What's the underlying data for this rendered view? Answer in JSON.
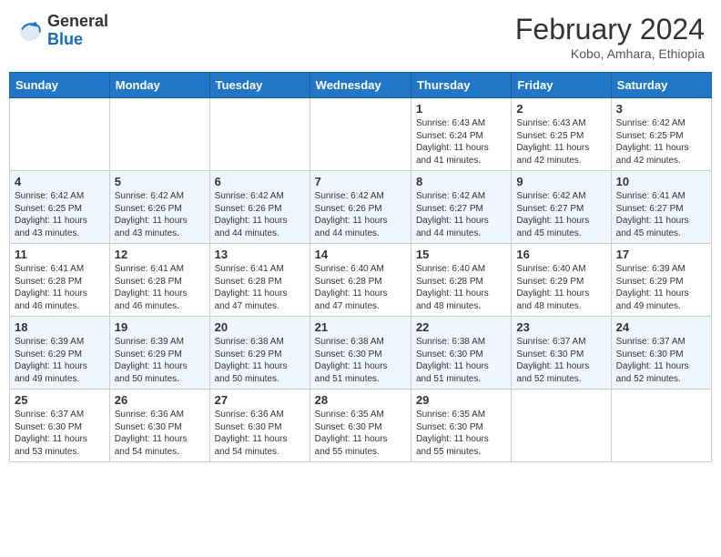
{
  "header": {
    "logo_general": "General",
    "logo_blue": "Blue",
    "month_year": "February 2024",
    "location": "Kobo, Amhara, Ethiopia"
  },
  "weekdays": [
    "Sunday",
    "Monday",
    "Tuesday",
    "Wednesday",
    "Thursday",
    "Friday",
    "Saturday"
  ],
  "weeks": [
    [
      {
        "day": "",
        "info": ""
      },
      {
        "day": "",
        "info": ""
      },
      {
        "day": "",
        "info": ""
      },
      {
        "day": "",
        "info": ""
      },
      {
        "day": "1",
        "info": "Sunrise: 6:43 AM\nSunset: 6:24 PM\nDaylight: 11 hours\nand 41 minutes."
      },
      {
        "day": "2",
        "info": "Sunrise: 6:43 AM\nSunset: 6:25 PM\nDaylight: 11 hours\nand 42 minutes."
      },
      {
        "day": "3",
        "info": "Sunrise: 6:42 AM\nSunset: 6:25 PM\nDaylight: 11 hours\nand 42 minutes."
      }
    ],
    [
      {
        "day": "4",
        "info": "Sunrise: 6:42 AM\nSunset: 6:25 PM\nDaylight: 11 hours\nand 43 minutes."
      },
      {
        "day": "5",
        "info": "Sunrise: 6:42 AM\nSunset: 6:26 PM\nDaylight: 11 hours\nand 43 minutes."
      },
      {
        "day": "6",
        "info": "Sunrise: 6:42 AM\nSunset: 6:26 PM\nDaylight: 11 hours\nand 44 minutes."
      },
      {
        "day": "7",
        "info": "Sunrise: 6:42 AM\nSunset: 6:26 PM\nDaylight: 11 hours\nand 44 minutes."
      },
      {
        "day": "8",
        "info": "Sunrise: 6:42 AM\nSunset: 6:27 PM\nDaylight: 11 hours\nand 44 minutes."
      },
      {
        "day": "9",
        "info": "Sunrise: 6:42 AM\nSunset: 6:27 PM\nDaylight: 11 hours\nand 45 minutes."
      },
      {
        "day": "10",
        "info": "Sunrise: 6:41 AM\nSunset: 6:27 PM\nDaylight: 11 hours\nand 45 minutes."
      }
    ],
    [
      {
        "day": "11",
        "info": "Sunrise: 6:41 AM\nSunset: 6:28 PM\nDaylight: 11 hours\nand 46 minutes."
      },
      {
        "day": "12",
        "info": "Sunrise: 6:41 AM\nSunset: 6:28 PM\nDaylight: 11 hours\nand 46 minutes."
      },
      {
        "day": "13",
        "info": "Sunrise: 6:41 AM\nSunset: 6:28 PM\nDaylight: 11 hours\nand 47 minutes."
      },
      {
        "day": "14",
        "info": "Sunrise: 6:40 AM\nSunset: 6:28 PM\nDaylight: 11 hours\nand 47 minutes."
      },
      {
        "day": "15",
        "info": "Sunrise: 6:40 AM\nSunset: 6:28 PM\nDaylight: 11 hours\nand 48 minutes."
      },
      {
        "day": "16",
        "info": "Sunrise: 6:40 AM\nSunset: 6:29 PM\nDaylight: 11 hours\nand 48 minutes."
      },
      {
        "day": "17",
        "info": "Sunrise: 6:39 AM\nSunset: 6:29 PM\nDaylight: 11 hours\nand 49 minutes."
      }
    ],
    [
      {
        "day": "18",
        "info": "Sunrise: 6:39 AM\nSunset: 6:29 PM\nDaylight: 11 hours\nand 49 minutes."
      },
      {
        "day": "19",
        "info": "Sunrise: 6:39 AM\nSunset: 6:29 PM\nDaylight: 11 hours\nand 50 minutes."
      },
      {
        "day": "20",
        "info": "Sunrise: 6:38 AM\nSunset: 6:29 PM\nDaylight: 11 hours\nand 50 minutes."
      },
      {
        "day": "21",
        "info": "Sunrise: 6:38 AM\nSunset: 6:30 PM\nDaylight: 11 hours\nand 51 minutes."
      },
      {
        "day": "22",
        "info": "Sunrise: 6:38 AM\nSunset: 6:30 PM\nDaylight: 11 hours\nand 51 minutes."
      },
      {
        "day": "23",
        "info": "Sunrise: 6:37 AM\nSunset: 6:30 PM\nDaylight: 11 hours\nand 52 minutes."
      },
      {
        "day": "24",
        "info": "Sunrise: 6:37 AM\nSunset: 6:30 PM\nDaylight: 11 hours\nand 52 minutes."
      }
    ],
    [
      {
        "day": "25",
        "info": "Sunrise: 6:37 AM\nSunset: 6:30 PM\nDaylight: 11 hours\nand 53 minutes."
      },
      {
        "day": "26",
        "info": "Sunrise: 6:36 AM\nSunset: 6:30 PM\nDaylight: 11 hours\nand 54 minutes."
      },
      {
        "day": "27",
        "info": "Sunrise: 6:36 AM\nSunset: 6:30 PM\nDaylight: 11 hours\nand 54 minutes."
      },
      {
        "day": "28",
        "info": "Sunrise: 6:35 AM\nSunset: 6:30 PM\nDaylight: 11 hours\nand 55 minutes."
      },
      {
        "day": "29",
        "info": "Sunrise: 6:35 AM\nSunset: 6:30 PM\nDaylight: 11 hours\nand 55 minutes."
      },
      {
        "day": "",
        "info": ""
      },
      {
        "day": "",
        "info": ""
      }
    ]
  ]
}
